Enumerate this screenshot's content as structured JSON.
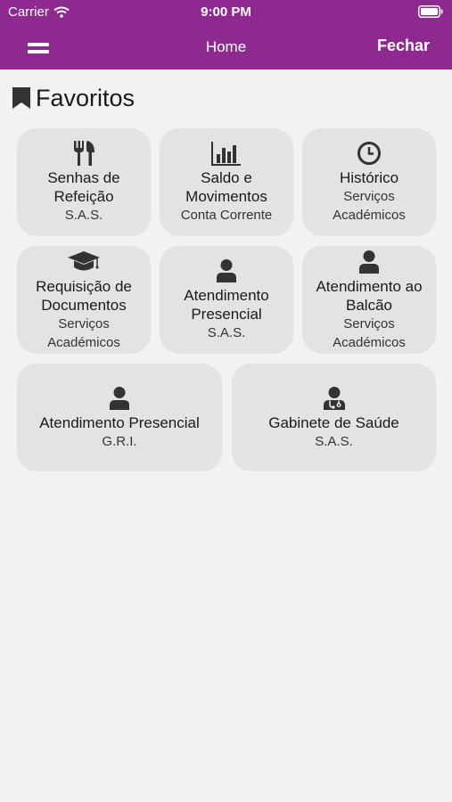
{
  "status_bar": {
    "carrier": "Carrier",
    "time": "9:00 PM"
  },
  "nav": {
    "title": "Home",
    "close_label": "Fechar"
  },
  "section": {
    "title": "Favoritos"
  },
  "tiles": [
    {
      "icon": "utensils-icon",
      "title": "Senhas de Refeição",
      "subtitle": "S.A.S."
    },
    {
      "icon": "bar-chart-icon",
      "title": "Saldo e Movimentos",
      "subtitle": "Conta Corrente"
    },
    {
      "icon": "clock-icon",
      "title": "Histórico",
      "subtitle": "Serviços Académicos"
    },
    {
      "icon": "graduation-cap-icon",
      "title": "Requisição de Documentos",
      "subtitle": "Serviços Académicos"
    },
    {
      "icon": "user-icon",
      "title": "Atendimento Presencial",
      "subtitle": "S.A.S."
    },
    {
      "icon": "user-icon",
      "title": "Atendimento ao Balcão",
      "subtitle": "Serviços Académicos"
    },
    {
      "icon": "user-icon",
      "title": "Atendimento Presencial",
      "subtitle": "G.R.I."
    },
    {
      "icon": "doctor-icon",
      "title": "Gabinete de Saúde",
      "subtitle": "S.A.S."
    }
  ]
}
